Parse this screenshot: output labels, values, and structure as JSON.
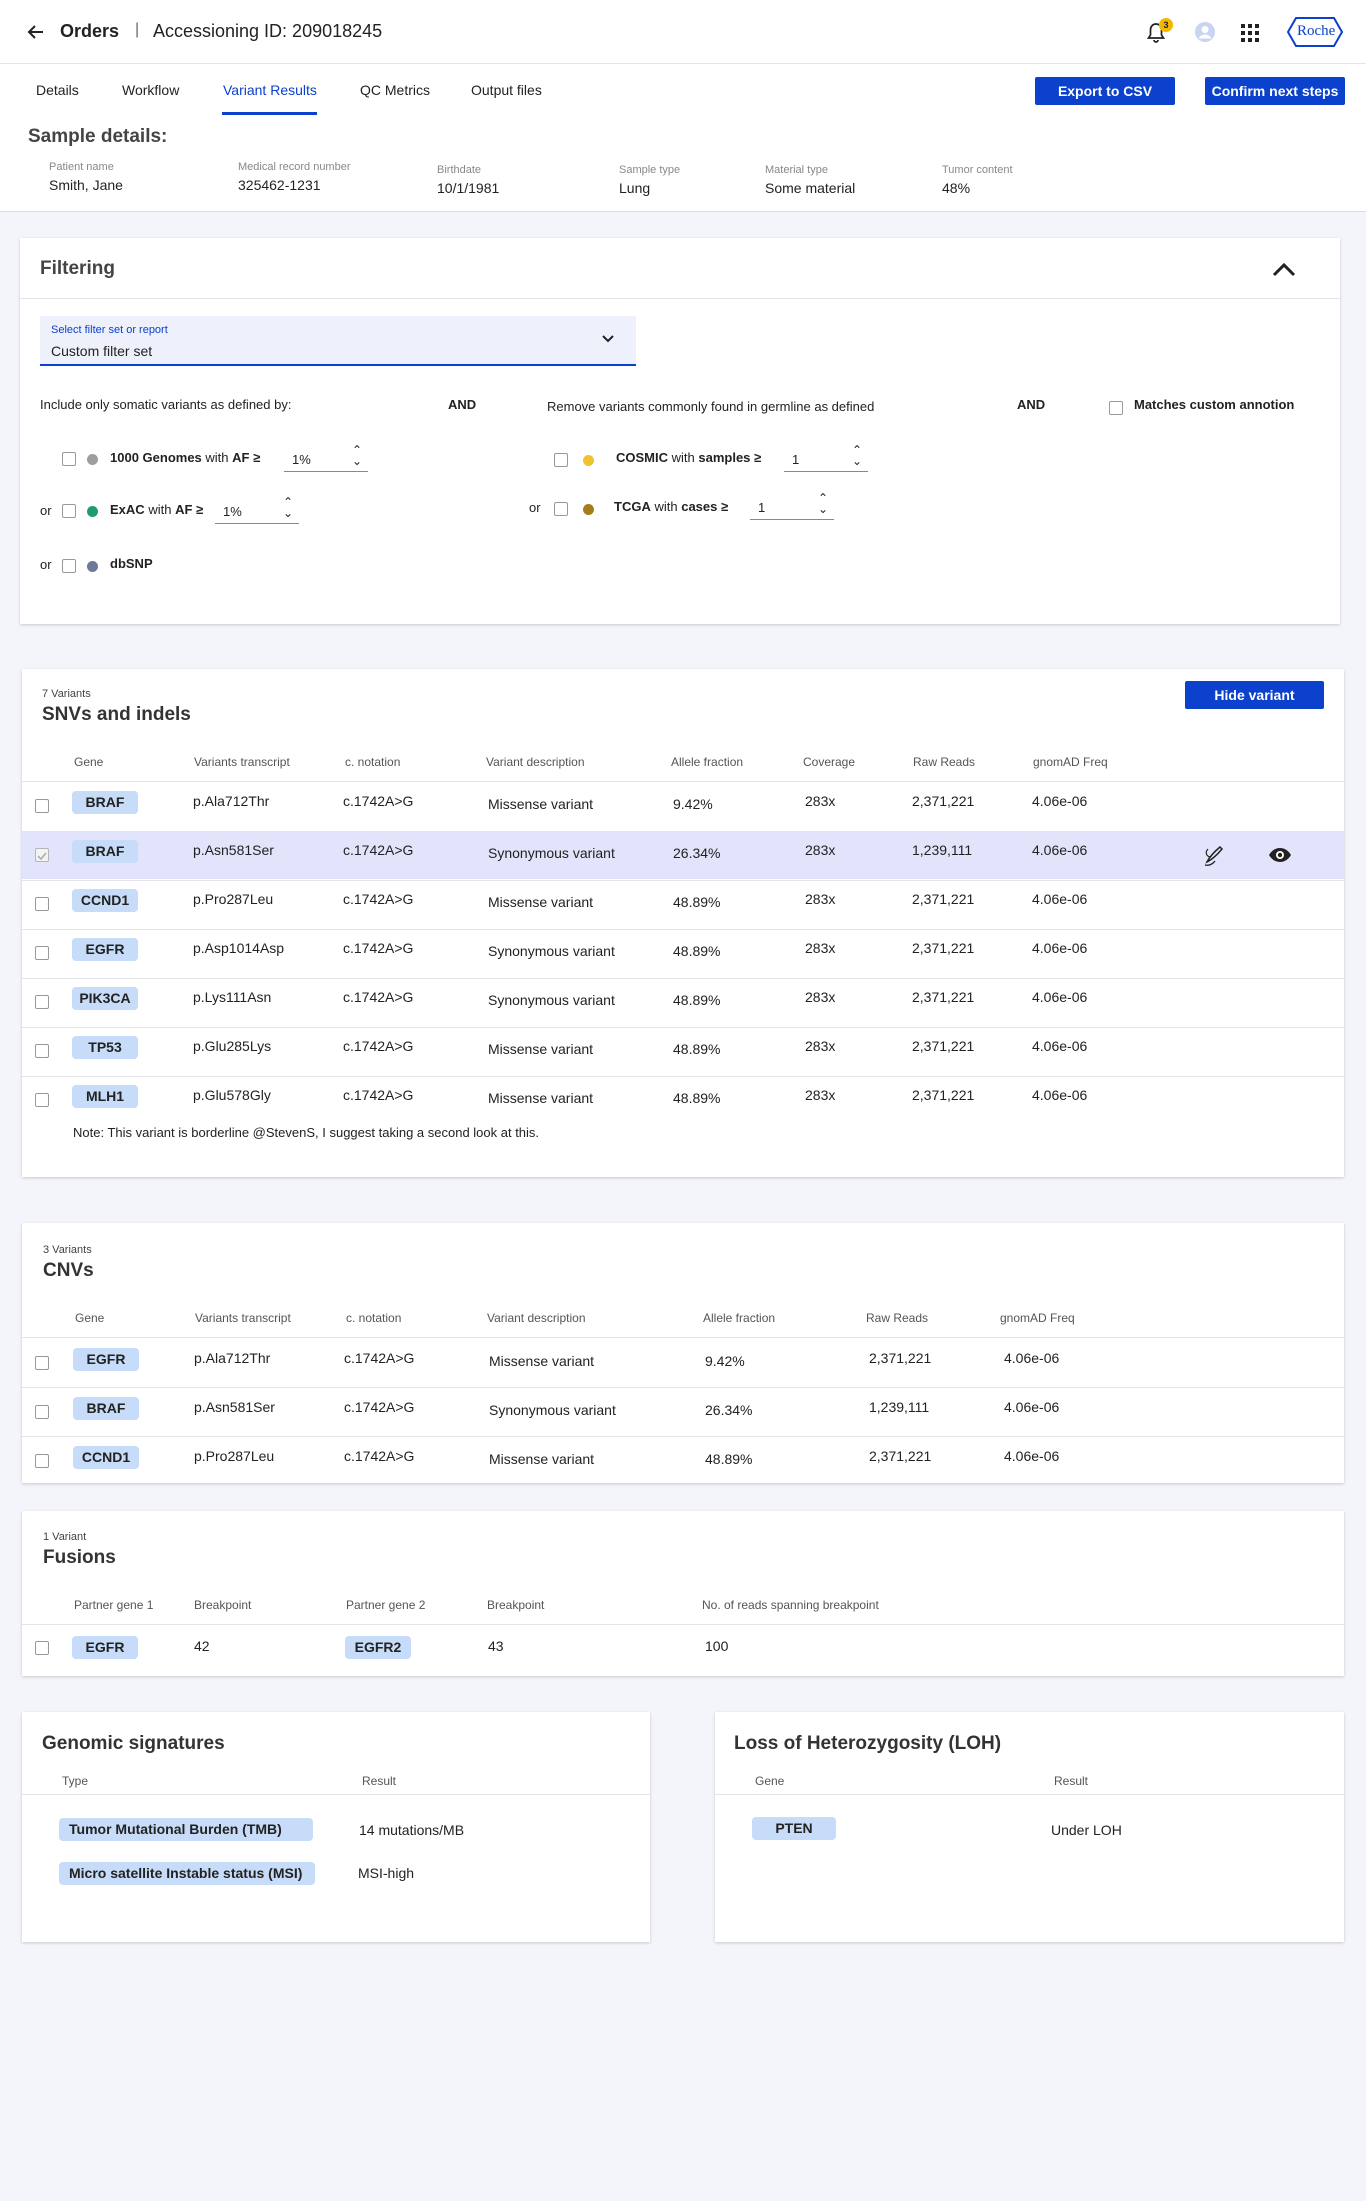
{
  "header": {
    "back_icon": "arrow-left-icon",
    "title": "Orders",
    "separator": "|",
    "accession": "Accessioning ID: 209018245",
    "notification_count": "3",
    "brand": "Roche"
  },
  "tabs": [
    "Details",
    "Workflow",
    "Variant Results",
    "QC Metrics",
    "Output files"
  ],
  "actions": {
    "export": "Export to CSV",
    "confirm": "Confirm next steps"
  },
  "sample": {
    "heading": "Sample details:",
    "fields": [
      {
        "label": "Patient name",
        "value": "Smith, Jane"
      },
      {
        "label": "Medical record number",
        "value": "325462-1231"
      },
      {
        "label": "Birthdate",
        "value": "10/1/1981"
      },
      {
        "label": "Sample type",
        "value": "Lung"
      },
      {
        "label": "Material type",
        "value": "Some material"
      },
      {
        "label": "Tumor content",
        "value": "48%"
      }
    ]
  },
  "filtering": {
    "title": "Filtering",
    "select_label": "Select filter set or report",
    "select_value": "Custom filter set",
    "somatic_text": "Include only somatic variants as defined by:",
    "and1": "AND",
    "germline_text": "Remove variants commonly found in germline as defined",
    "and2": "AND",
    "custom_label": "Matches custom annotion",
    "or": "or",
    "g1000": {
      "name": "1000 Genomes",
      "mid": "with",
      "metric": "AF ≥",
      "value": "1%",
      "color": "#9e9e9e"
    },
    "exac": {
      "name": "ExAC",
      "mid": "with",
      "metric": "AF ≥",
      "value": "1%",
      "color": "#1f9b6e"
    },
    "dbsnp": {
      "name": "dbSNP",
      "color": "#6b7a99"
    },
    "cosmic": {
      "name": "COSMIC",
      "mid": "with",
      "metric": "samples ≥",
      "value": "1",
      "color": "#f2c12e"
    },
    "tcga": {
      "name": "TCGA",
      "mid": "with",
      "metric": "cases ≥",
      "value": "1",
      "color": "#a67c1a"
    }
  },
  "snv": {
    "count": "7 Variants",
    "title": "SNVs and indels",
    "hide_button": "Hide variant",
    "headers": [
      "Gene",
      "Variants transcript",
      "c. notation",
      "Variant description",
      "Allele fraction",
      "Coverage",
      "Raw Reads",
      "gnomAD Freq"
    ],
    "rows": [
      {
        "gene": "BRAF",
        "transcript": "p.Ala712Thr",
        "cnot": "c.1742A>G",
        "desc": "Missense variant",
        "af": "9.42%",
        "cov": "283x",
        "reads": "2,371,221",
        "gnomad": "4.06e-06"
      },
      {
        "gene": "BRAF",
        "transcript": "p.Asn581Ser",
        "cnot": "c.1742A>G",
        "desc": "Synonymous variant",
        "af": "26.34%",
        "cov": "283x",
        "reads": "1,239,111",
        "gnomad": "4.06e-06"
      },
      {
        "gene": "CCND1",
        "transcript": "p.Pro287Leu",
        "cnot": "c.1742A>G",
        "desc": "Missense variant",
        "af": "48.89%",
        "cov": "283x",
        "reads": "2,371,221",
        "gnomad": "4.06e-06"
      },
      {
        "gene": "EGFR",
        "transcript": "p.Asp1014Asp",
        "cnot": "c.1742A>G",
        "desc": "Synonymous variant",
        "af": "48.89%",
        "cov": "283x",
        "reads": "2,371,221",
        "gnomad": "4.06e-06"
      },
      {
        "gene": "PIK3CA",
        "transcript": "p.Lys111Asn",
        "cnot": "c.1742A>G",
        "desc": "Synonymous variant",
        "af": "48.89%",
        "cov": "283x",
        "reads": "2,371,221",
        "gnomad": "4.06e-06"
      },
      {
        "gene": "TP53",
        "transcript": "p.Glu285Lys",
        "cnot": "c.1742A>G",
        "desc": "Missense variant",
        "af": "48.89%",
        "cov": "283x",
        "reads": "2,371,221",
        "gnomad": "4.06e-06"
      },
      {
        "gene": "MLH1",
        "transcript": "p.Glu578Gly",
        "cnot": "c.1742A>G",
        "desc": "Missense variant",
        "af": "48.89%",
        "cov": "283x",
        "reads": "2,371,221",
        "gnomad": "4.06e-06"
      }
    ],
    "note": "Note: This variant is borderline @StevenS, I suggest taking a second look at this."
  },
  "cnv": {
    "count": "3 Variants",
    "title": "CNVs",
    "headers": [
      "Gene",
      "Variants transcript",
      "c. notation",
      "Variant description",
      "Allele fraction",
      "Raw Reads",
      "gnomAD Freq"
    ],
    "rows": [
      {
        "gene": "EGFR",
        "transcript": "p.Ala712Thr",
        "cnot": "c.1742A>G",
        "desc": "Missense variant",
        "af": "9.42%",
        "reads": "2,371,221",
        "gnomad": "4.06e-06"
      },
      {
        "gene": "BRAF",
        "transcript": "p.Asn581Ser",
        "cnot": "c.1742A>G",
        "desc": "Synonymous variant",
        "af": "26.34%",
        "reads": "1,239,111",
        "gnomad": "4.06e-06"
      },
      {
        "gene": "CCND1",
        "transcript": "p.Pro287Leu",
        "cnot": "c.1742A>G",
        "desc": "Missense variant",
        "af": "48.89%",
        "reads": "2,371,221",
        "gnomad": "4.06e-06"
      }
    ]
  },
  "fusions": {
    "count": "1 Variant",
    "title": "Fusions",
    "headers": [
      "Partner gene 1",
      "Breakpoint",
      "Partner gene 2",
      "Breakpoint",
      "No. of reads spanning breakpoint"
    ],
    "row": {
      "gene1": "EGFR",
      "bp1": "42",
      "gene2": "EGFR2",
      "bp2": "43",
      "reads": "100"
    }
  },
  "genomic": {
    "title": "Genomic signatures",
    "headers": [
      "Type",
      "Result"
    ],
    "rows": [
      {
        "type": "Tumor Mutational Burden (TMB)",
        "result": "14 mutations/MB"
      },
      {
        "type": "Micro satellite Instable status (MSI)",
        "result": "MSI-high"
      }
    ]
  },
  "loh": {
    "title": "Loss of Heterozygosity (LOH)",
    "headers": [
      "Gene",
      "Result"
    ],
    "rows": [
      {
        "gene": "PTEN",
        "result": "Under LOH"
      }
    ]
  }
}
